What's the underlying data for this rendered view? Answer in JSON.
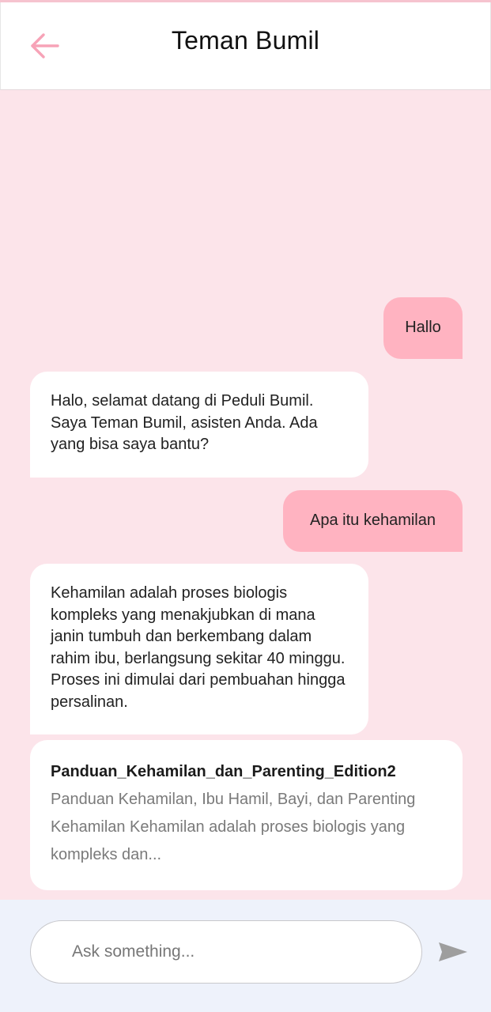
{
  "app_bar": {
    "title": "Teman Bumil",
    "back_icon": "arrow-left-icon",
    "accent_color": "#f7a3b7"
  },
  "messages": [
    {
      "role": "user",
      "text": "Hallo"
    },
    {
      "role": "bot",
      "text": "Halo, selamat datang di Peduli Bumil. Saya Teman Bumil, asisten Anda. Ada yang bisa saya bantu?"
    },
    {
      "role": "user",
      "text": "Apa itu kehamilan"
    },
    {
      "role": "bot",
      "text": "Kehamilan adalah proses biologis kompleks yang menakjubkan di mana janin tumbuh dan berkembang dalam rahim ibu, berlangsung sekitar 40 minggu. Proses ini dimulai dari pembuahan hingga persalinan."
    }
  ],
  "source_card": {
    "title": "Panduan_Kehamilan_dan_Parenting_Edition2",
    "snippet": "Panduan Kehamilan, Ibu Hamil, Bayi, dan Parenting Kehamilan Kehamilan adalah proses biologis yang kompleks dan..."
  },
  "composer": {
    "placeholder": "Ask something...",
    "value": "",
    "send_icon": "send-icon"
  },
  "colors": {
    "chat_background": "#fce4ea",
    "user_bubble": "#ffb3c1",
    "bot_bubble": "#ffffff",
    "composer_background": "#eef2fb",
    "send_icon": "#9e9e9e"
  }
}
